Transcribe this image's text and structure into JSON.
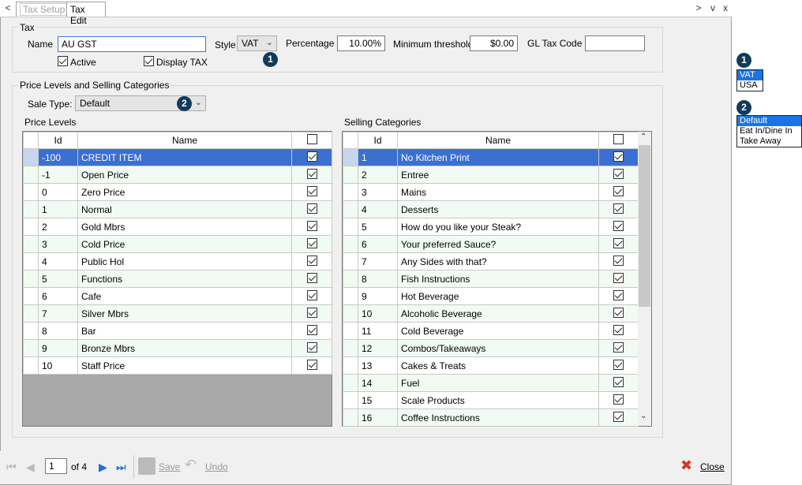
{
  "tabs": {
    "inactive": "Tax Setup",
    "active": "Tax Edit"
  },
  "window_controls": {
    "prev": "<",
    "next": ">",
    "down": "v",
    "close": "x"
  },
  "tax": {
    "group_title": "Tax",
    "name_label": "Name",
    "name_value": "AU GST",
    "style_label": "Style",
    "style_value": "VAT",
    "percentage_label": "Percentage",
    "percentage_value": "10.00%",
    "min_threshold_label": "Minimum threshold",
    "min_threshold_value": "$0.00",
    "gl_code_label": "GL Tax Code",
    "gl_code_value": "",
    "active_label": "Active",
    "active_checked": true,
    "display_tax_label": "Display TAX",
    "display_tax_checked": true
  },
  "price_group": {
    "title": "Price Levels and Selling Categories",
    "sale_type_label": "Sale Type:",
    "sale_type_value": "Default",
    "price_levels_label": "Price Levels",
    "selling_categories_label": "Selling Categories"
  },
  "price_levels": {
    "columns": [
      "Id",
      "Name"
    ],
    "rows": [
      {
        "id": "-100",
        "name": "CREDIT ITEM",
        "checked": true,
        "selected": true
      },
      {
        "id": "-1",
        "name": "Open Price",
        "checked": true
      },
      {
        "id": "0",
        "name": "Zero Price",
        "checked": true
      },
      {
        "id": "1",
        "name": "Normal",
        "checked": true
      },
      {
        "id": "2",
        "name": "Gold Mbrs",
        "checked": true
      },
      {
        "id": "3",
        "name": "Cold Price",
        "checked": true
      },
      {
        "id": "4",
        "name": "Public Hol",
        "checked": true
      },
      {
        "id": "5",
        "name": "Functions",
        "checked": true
      },
      {
        "id": "6",
        "name": "Cafe",
        "checked": true
      },
      {
        "id": "7",
        "name": "Silver Mbrs",
        "checked": true
      },
      {
        "id": "8",
        "name": "Bar",
        "checked": true
      },
      {
        "id": "9",
        "name": "Bronze Mbrs",
        "checked": true
      },
      {
        "id": "10",
        "name": "Staff Price",
        "checked": true
      }
    ]
  },
  "selling_categories": {
    "columns": [
      "Id",
      "Name"
    ],
    "rows": [
      {
        "id": "1",
        "name": "No Kitchen Print",
        "checked": true,
        "selected": true
      },
      {
        "id": "2",
        "name": "Entree",
        "checked": true
      },
      {
        "id": "3",
        "name": "Mains",
        "checked": true
      },
      {
        "id": "4",
        "name": "Desserts",
        "checked": true
      },
      {
        "id": "5",
        "name": "How do you like your Steak?",
        "checked": true
      },
      {
        "id": "6",
        "name": "Your preferred Sauce?",
        "checked": true
      },
      {
        "id": "7",
        "name": "Any Sides with that?",
        "checked": true
      },
      {
        "id": "8",
        "name": "Fish Instructions",
        "checked": true
      },
      {
        "id": "9",
        "name": "Hot Beverage",
        "checked": true
      },
      {
        "id": "10",
        "name": "Alcoholic Beverage",
        "checked": true
      },
      {
        "id": "11",
        "name": "Cold Beverage",
        "checked": true
      },
      {
        "id": "12",
        "name": "Combos/Takeaways",
        "checked": true
      },
      {
        "id": "13",
        "name": "Cakes & Treats",
        "checked": true
      },
      {
        "id": "14",
        "name": "Fuel",
        "checked": true
      },
      {
        "id": "15",
        "name": "Scale Products",
        "checked": true
      },
      {
        "id": "16",
        "name": "Coffee Instructions",
        "checked": true
      }
    ]
  },
  "pager": {
    "page": "1",
    "of_label": "of 4",
    "save_label": "Save",
    "undo_label": "Undo",
    "close_label": "Close"
  },
  "callouts": {
    "badge1": "1",
    "badge2": "2",
    "style_options": [
      "VAT",
      "USA"
    ],
    "sale_type_options": [
      "Default",
      "Eat In/Dine In",
      "Take Away"
    ]
  }
}
